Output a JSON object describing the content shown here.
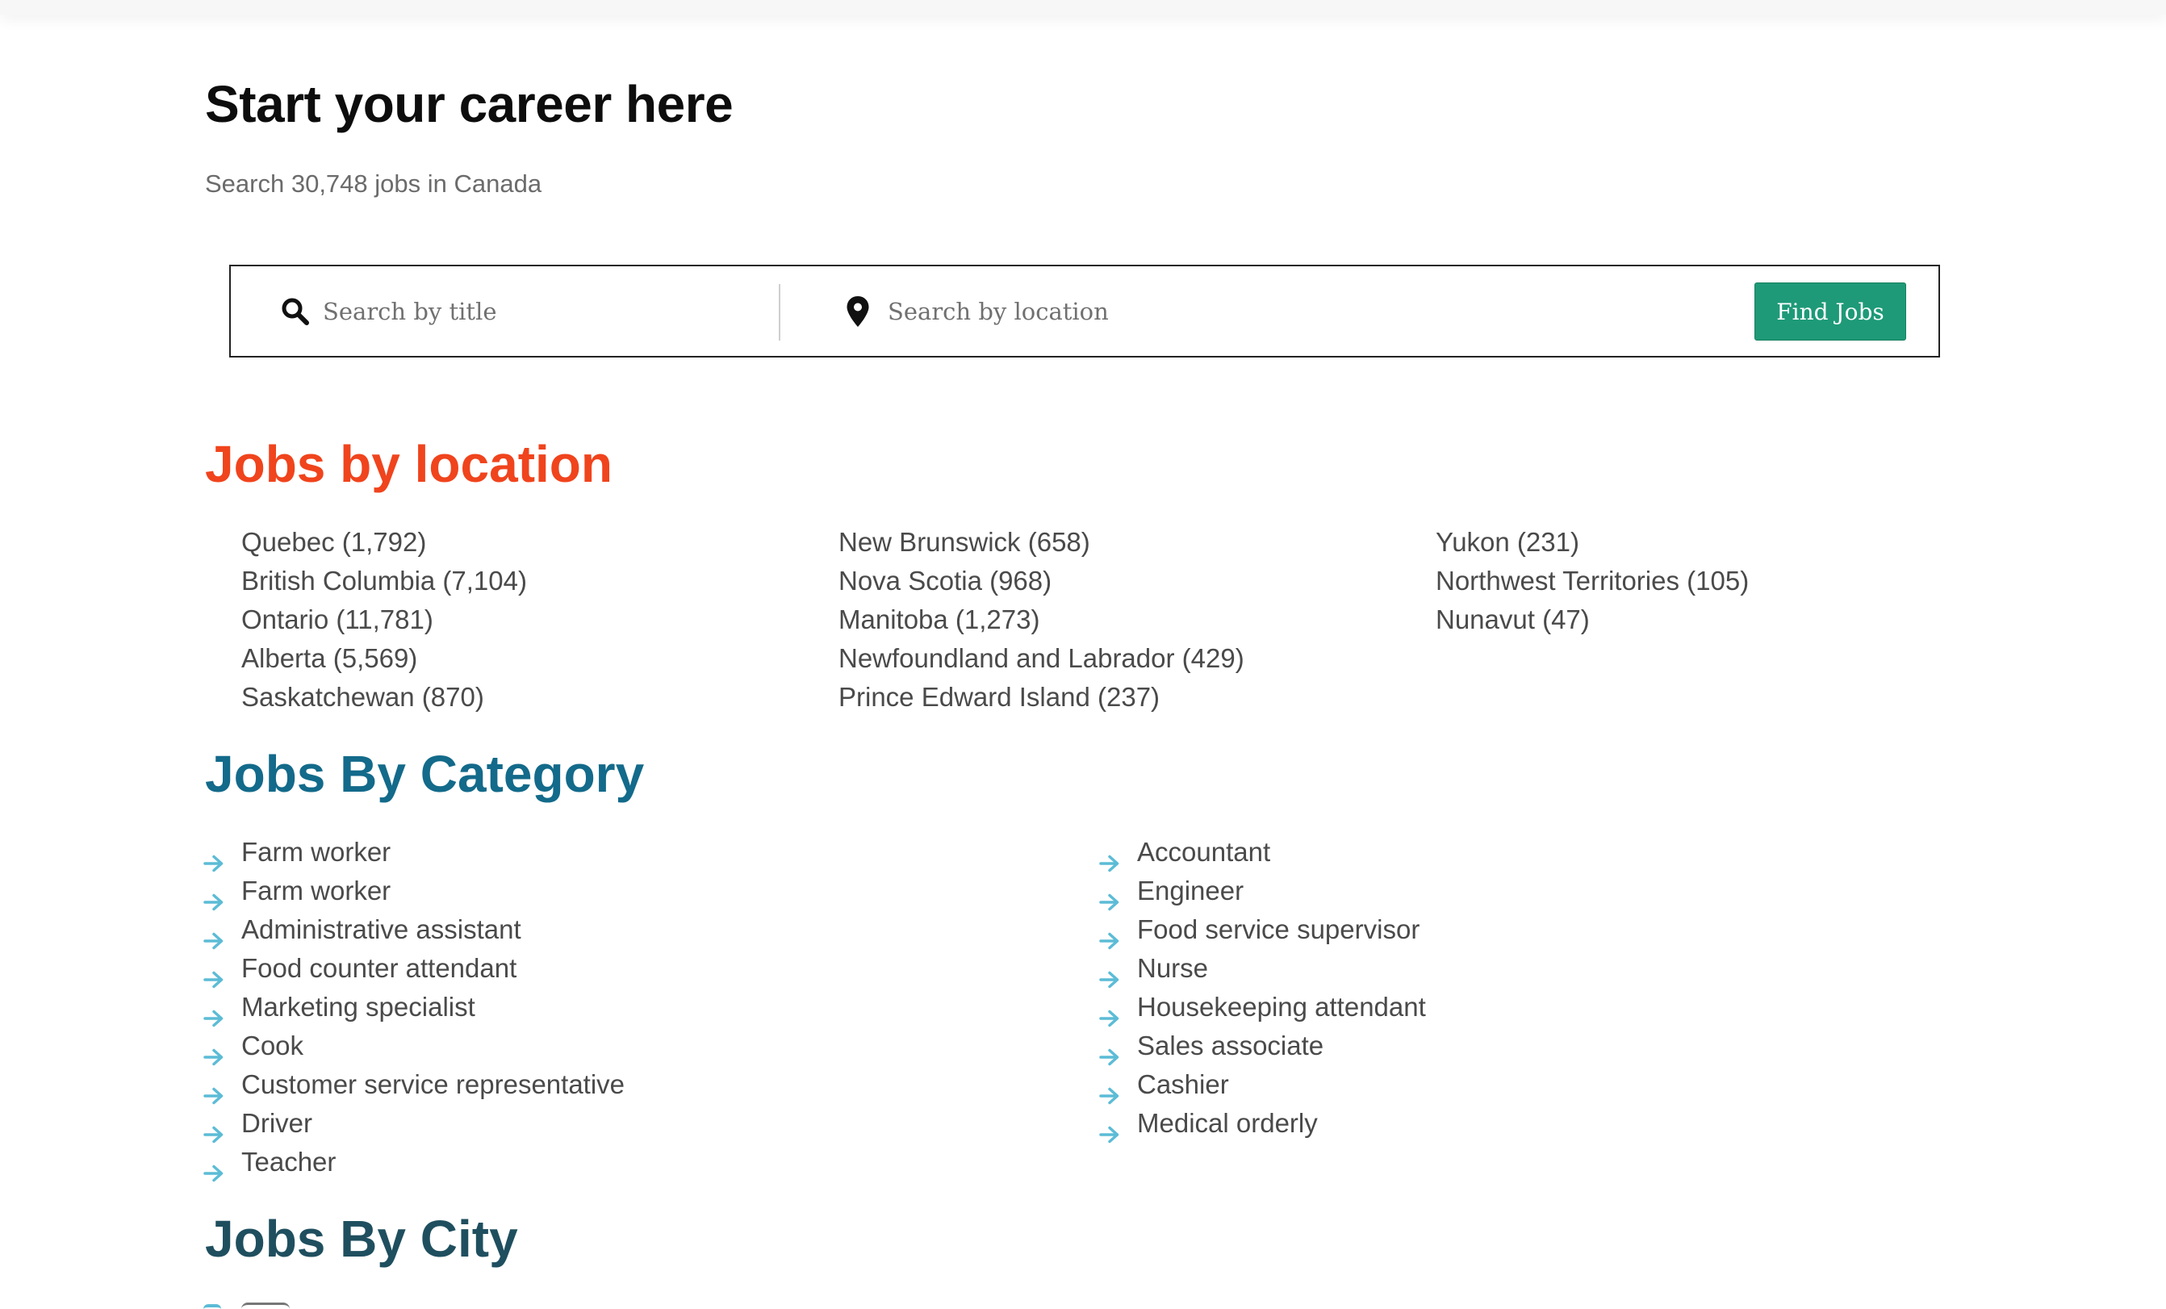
{
  "header": {
    "title": "Start your career here",
    "subtitle": "Search 30,748 jobs in Canada"
  },
  "search": {
    "title_placeholder": "Search by title",
    "location_placeholder": "Search by location",
    "button_label": "Find Jobs",
    "button_color": "#1e9a78"
  },
  "locations": {
    "heading": "Jobs by location",
    "heading_color": "#f0441d",
    "columns": [
      [
        "Quebec (1,792)",
        "British Columbia (7,104)",
        "Ontario (11,781)",
        "Alberta (5,569)",
        "Saskatchewan (870)"
      ],
      [
        "New Brunswick (658)",
        "Nova Scotia (968)",
        "Manitoba (1,273)",
        "Newfoundland and Labrador (429)",
        "Prince Edward Island (237)"
      ],
      [
        "Yukon (231)",
        "Northwest Territories (105)",
        "Nunavut (47)"
      ]
    ]
  },
  "categories": {
    "heading": "Jobs By Category",
    "heading_color": "#136a8a",
    "icon": "arrow-right-icon",
    "icon_color": "#5cbcd6",
    "columns": [
      [
        "Farm worker",
        "Farm worker",
        "Administrative assistant",
        "Food counter attendant",
        "Marketing specialist",
        "Cook",
        "Customer service representative",
        "Driver",
        "Teacher"
      ],
      [
        "Accountant",
        "Engineer",
        "Food service supervisor",
        "Nurse",
        "Housekeeping attendant",
        "Sales associate",
        "Cashier",
        "Medical orderly"
      ]
    ]
  },
  "cities": {
    "heading": "Jobs By City",
    "heading_color": "#1f4f5f"
  }
}
